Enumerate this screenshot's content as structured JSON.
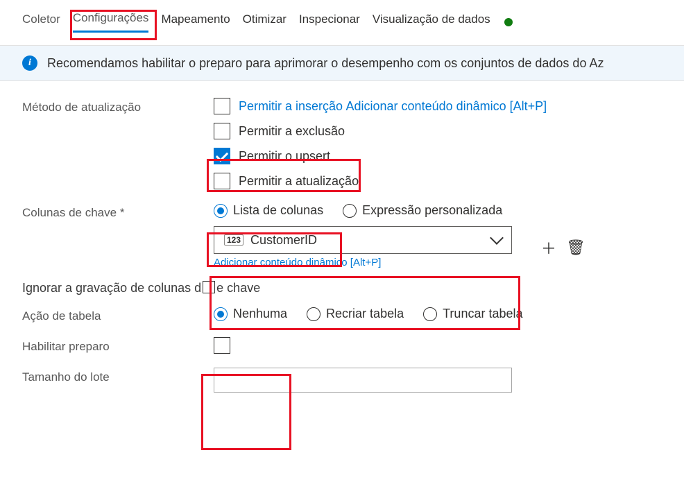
{
  "tabs": {
    "coletor": "Coletor",
    "configuracoes": "Configurações",
    "mapeamento": "Mapeamento",
    "otimizar": "Otimizar",
    "inspecionar": "Inspecionar",
    "visualizacao": "Visualização de dados"
  },
  "banner": {
    "info_icon": "i",
    "text": "Recomendamos habilitar o preparo para aprimorar o desempenho com os conjuntos de dados do Az"
  },
  "update_method": {
    "label": "Método de atualização",
    "allow_insert": "Permitir a inserção",
    "allow_insert_dyn": "Adicionar conteúdo dinâmico [Alt+P]",
    "allow_delete": "Permitir a exclusão",
    "allow_upsert": "Permitir o upsert",
    "allow_update": "Permitir a atualização"
  },
  "key_columns": {
    "label": "Colunas de chave *",
    "option_list": "Lista de colunas",
    "option_expr": "Expressão personalizada",
    "selected_type": "123",
    "selected_value": "CustomerID",
    "dyn_link": "Adicionar conteúdo dinâmico [Alt+P]"
  },
  "skip_key_write": {
    "label": "Ignorar a gravação de colunas de chave"
  },
  "table_action": {
    "label": "Ação de tabela",
    "none": "Nenhuma",
    "recreate": "Recriar tabela",
    "truncate": "Truncar tabela"
  },
  "staging": {
    "label": "Habilitar preparo"
  },
  "batch": {
    "label": "Tamanho do lote",
    "value": ""
  }
}
